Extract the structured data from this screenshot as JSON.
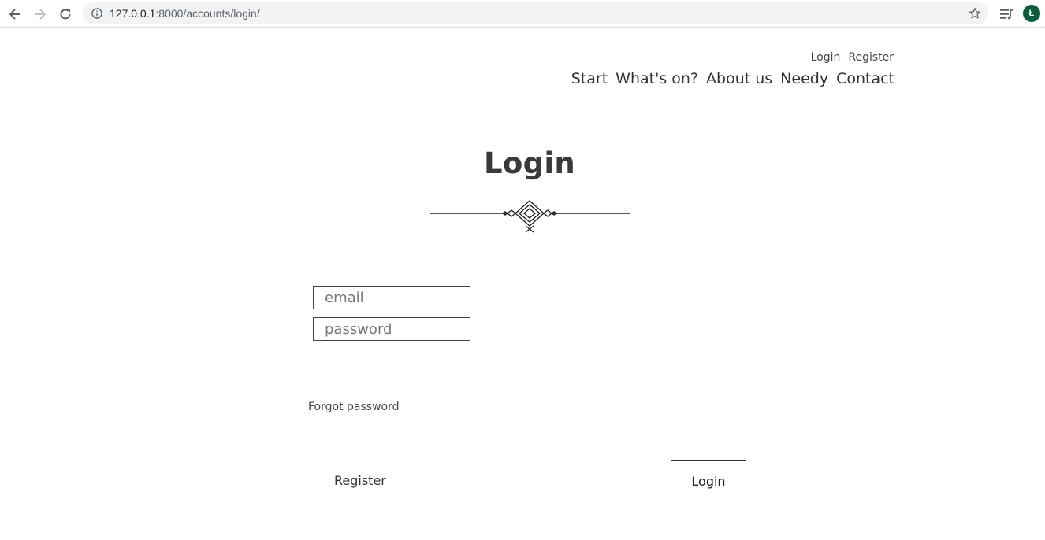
{
  "browser": {
    "url_host": "127.0.0.1",
    "url_rest": ":8000/accounts/login/",
    "avatar_letter": "Ł",
    "avatar_color": "#0b5c3a"
  },
  "header": {
    "auth_links": [
      {
        "label": "Login"
      },
      {
        "label": "Register"
      }
    ],
    "nav": [
      {
        "label": "Start"
      },
      {
        "label": "What's on?"
      },
      {
        "label": "About us"
      },
      {
        "label": "Needy"
      },
      {
        "label": "Contact"
      }
    ]
  },
  "page": {
    "title": "Login"
  },
  "form": {
    "email_placeholder": "email",
    "email_value": "",
    "password_placeholder": "password",
    "password_value": "",
    "forgot_label": "Forgot password",
    "register_label": "Register",
    "submit_label": "Login"
  },
  "icons": [
    "back-arrow-icon",
    "forward-arrow-icon",
    "reload-icon",
    "info-icon",
    "star-icon",
    "playlist-icon",
    "ornament-divider-icon"
  ]
}
